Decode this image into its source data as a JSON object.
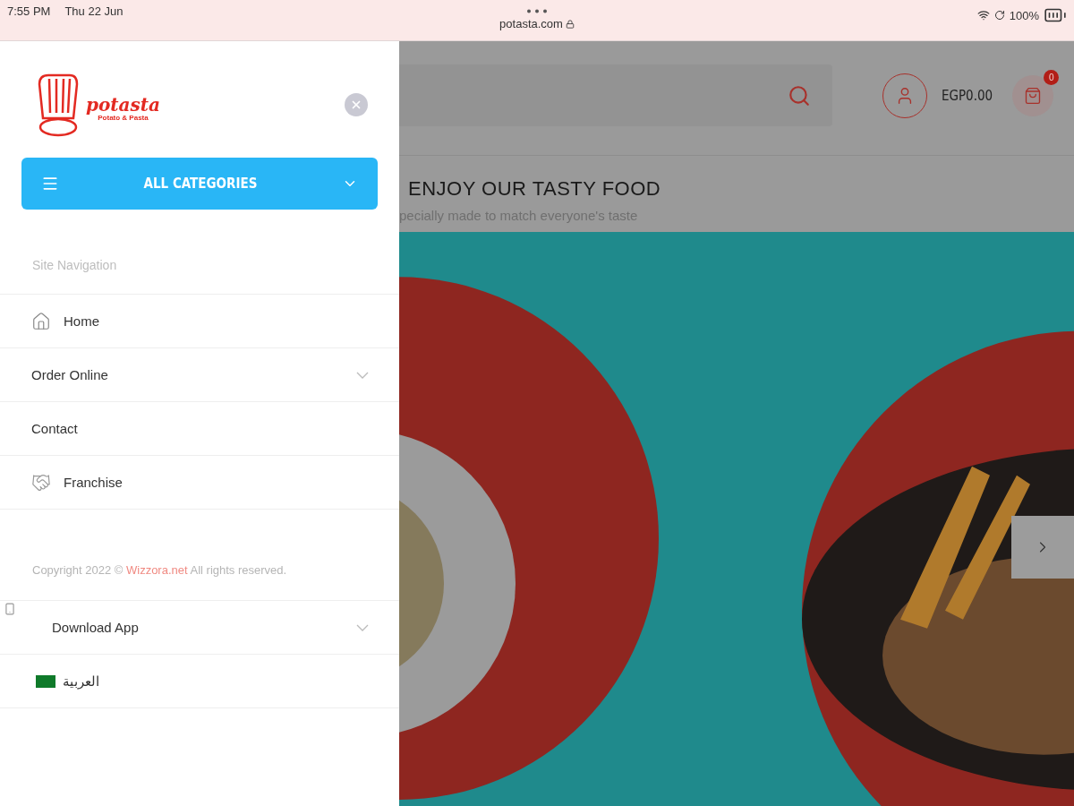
{
  "status_bar": {
    "time": "7:55 PM",
    "date": "Thu 22 Jun",
    "url": "potasta.com",
    "battery": "100%"
  },
  "drawer": {
    "logo": {
      "name": "potasta",
      "tagline": "Potato & Pasta"
    },
    "categories_button": {
      "label": "ALL CATEGORIES"
    },
    "section_title": "Site Navigation",
    "menu": [
      {
        "label": "Home",
        "kind": "home"
      },
      {
        "label": "Order Online",
        "kind": "submenu"
      },
      {
        "label": "Contact",
        "kind": "plain"
      },
      {
        "label": "Franchise",
        "kind": "franchise"
      }
    ],
    "copyright": {
      "before": "Copyright 2022 © ",
      "link": "Wizzora.net",
      "after": " All rights reserved."
    },
    "footer_menu": [
      {
        "label": "Download App",
        "kind": "app"
      },
      {
        "label": "العربية",
        "kind": "language"
      }
    ]
  },
  "header": {
    "balance": "EGP0.00",
    "cart_count": "0"
  },
  "intro": {
    "heading": "ENJOY OUR TASTY FOOD",
    "subheading": "pecially made to match everyone's taste"
  }
}
